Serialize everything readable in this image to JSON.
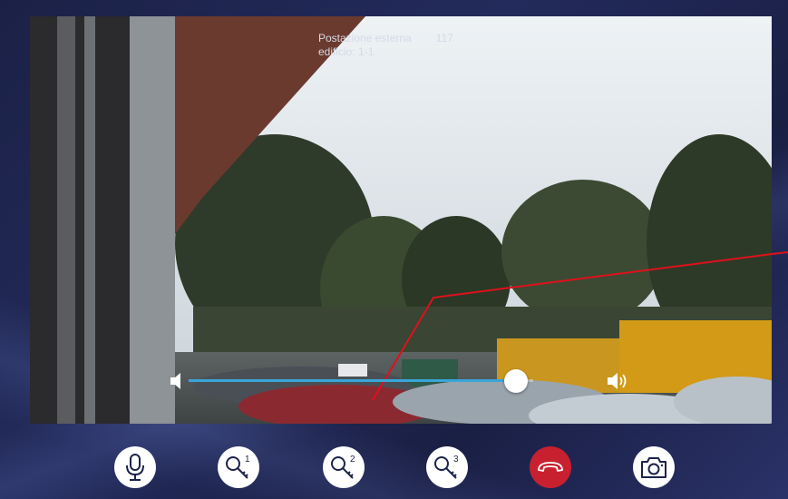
{
  "caller": {
    "station_label": "Postazione esterna",
    "station_number": "117",
    "building": "edificio: 1-1"
  },
  "volume": {
    "level": 0.95,
    "fill_color": "#39a5d8",
    "low_icon": "speaker-low-icon",
    "high_icon": "speaker-high-icon"
  },
  "controls": [
    {
      "name": "microphone-button",
      "icon": "microphone-icon"
    },
    {
      "name": "key-1-button",
      "icon": "key-icon",
      "badge": "1"
    },
    {
      "name": "key-2-button",
      "icon": "key-icon",
      "badge": "2"
    },
    {
      "name": "key-3-button",
      "icon": "key-icon",
      "badge": "3"
    },
    {
      "name": "hang-up-button",
      "icon": "phone-hangup-icon",
      "color": "#c9202f"
    },
    {
      "name": "snapshot-button",
      "icon": "camera-icon"
    }
  ]
}
